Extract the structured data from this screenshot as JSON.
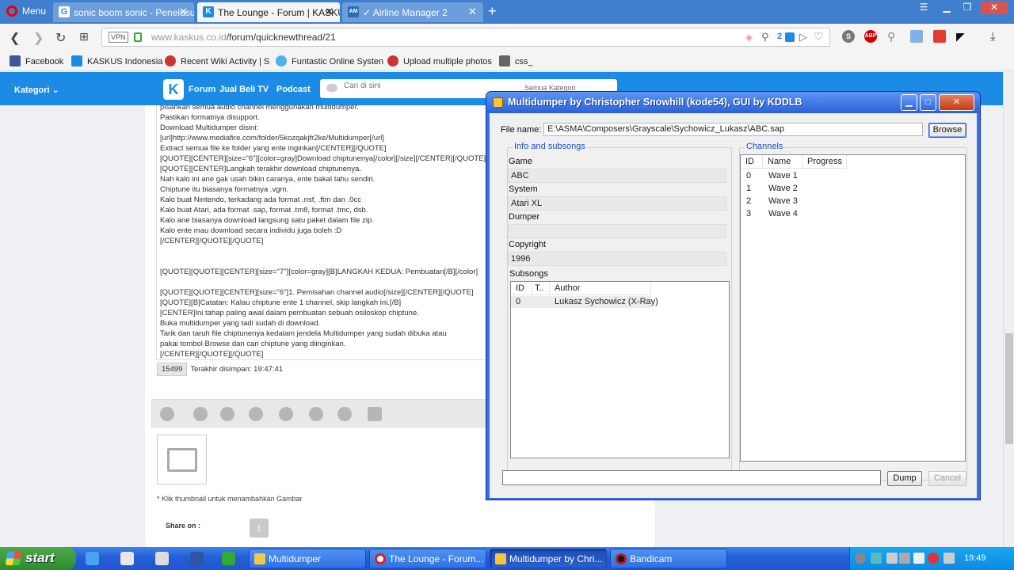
{
  "browser": {
    "menu_label": "Menu",
    "tabs": [
      {
        "title": "sonic boom sonic - Penelusur",
        "fav_color": "#4285f4",
        "fav_glyph": "G"
      },
      {
        "title": "The Lounge - Forum | KASKUS",
        "fav_color": "#1b8be6",
        "fav_glyph": "K"
      },
      {
        "title": "✓ Airline Manager 2",
        "fav_color": "#2a6db5",
        "fav_glyph": "AM"
      }
    ],
    "url_host": "www.kaskus.co.id",
    "url_path": "/forum/quicknewthread/21",
    "vpn_label": "VPN",
    "badge_count": "2",
    "bookmarks": [
      "Facebook",
      "KASKUS Indonesia",
      "Recent Wiki Activity | S",
      "Funtastic Online Systen",
      "Upload multiple photos",
      "css_"
    ]
  },
  "kaskus": {
    "kategori": "Kategori",
    "nav": [
      "Forum",
      "Jual Beli",
      "TV",
      "Podcast"
    ],
    "search_placeholder": "Cari di sini",
    "search_category": "Semua Kategori",
    "editor_lines": [
      "pisahkan semua audio channel menggunakan multidumper.",
      "Pastikan formatnya disupport.",
      "Download Multidumper disini:",
      "[url]http://www.mediafire.com/folder/5kozqakjfr2ke/Multidumper[/url]",
      "Extract semua file ke folder yang ente inginkan[/CENTER][/QUOTE]",
      "[QUOTE][CENTER][size=\"6\"][color=gray]Download chiptunenya[/color][/size][/CENTER][/QUOTE]",
      "[QUOTE][CENTER]Langkah terakhir download chiptunenya.",
      "Nah kalo ini ane gak usah bikin caranya, ente bakal tahu sendiri.",
      "Chiptune itu biasanya formatnya .vgm.",
      "Kalo buat Nintendo, terkadang ada format .nsf, .ftm dan .0cc",
      "Kalo buat Atari, ada format .sap, format .tm8, format .tmc, dsb.",
      "Kalo ane biasanya download langsung satu paket dalam file zip.",
      "Kalo ente mau download secara individu juga boleh :D",
      "[/CENTER][/QUOTE][/QUOTE]",
      "",
      "",
      "[QUOTE][QUOTE][CENTER][size=\"7\"][color=gray][B]LANGKAH KEDUA: Pembuatan[/B][/color]",
      "",
      "[QUOTE][QUOTE][CENTER][size=\"6\"]1. Pemisahan channel audio[/size][/CENTER][/QUOTE]",
      "[QUOTE][B]Catatan: Kalau chiptune ente 1 channel, skip langkah ini.[/B]",
      "[CENTER]Ini tahap paling awal dalam pembuatan sebuah osiloskop chiptune.",
      "Buka multidumper yang tadi sudah di download.",
      "Tarik dan taruh file chiptunenya kedalam jendela Multidumper yang sudah dibuka atau",
      "pakai tombol Browse dan cari chiptune yang diinginkan.",
      "[/CENTER][/QUOTE][/QUOTE]"
    ],
    "char_count": "15499",
    "saved_text": "Terakhir disimpan: 19:47:41",
    "thumb_hint": "* Klik thumbnail untuk menambahkan Gambar",
    "share_label": "Share on :"
  },
  "dialog": {
    "title": "Multidumper by Christopher Snowhill (kode54), GUI by KDDLB",
    "file_label": "File name:",
    "file_value": "E:\\ASMA\\Composers\\Grayscale\\Sychowicz_Lukasz\\ABC.sap",
    "browse_label": "Browse",
    "info_group": "Info and subsongs",
    "game_label": "Game",
    "game_value": "ABC",
    "system_label": "System",
    "system_value": "Atari XL",
    "dumper_label": "Dumper",
    "dumper_value": "",
    "copyright_label": "Copyright",
    "copyright_value": "1996",
    "subsongs_label": "Subsongs",
    "subsong_headers": [
      "ID",
      "T..",
      "Author"
    ],
    "subsongs": [
      {
        "id": "0",
        "t": "",
        "author": "Lukasz Sychowicz (X-Ray)"
      }
    ],
    "channels_group": "Channels",
    "channel_headers": [
      "ID",
      "Name",
      "Progress"
    ],
    "channels": [
      {
        "id": "0",
        "name": "Wave 1"
      },
      {
        "id": "1",
        "name": "Wave 2"
      },
      {
        "id": "2",
        "name": "Wave 3"
      },
      {
        "id": "3",
        "name": "Wave 4"
      }
    ],
    "dump_label": "Dump",
    "cancel_label": "Cancel"
  },
  "taskbar": {
    "start_label": "start",
    "tasks": [
      {
        "label": "Multidumper",
        "fav_color": "#f2c94c"
      },
      {
        "label": "The Lounge - Forum...",
        "fav_color": "#e02020"
      },
      {
        "label": "Multidumper by Chri...",
        "fav_color": "#f6c53a"
      },
      {
        "label": "Bandicam",
        "fav_color": "#c01818"
      }
    ],
    "clock": "19:49"
  }
}
